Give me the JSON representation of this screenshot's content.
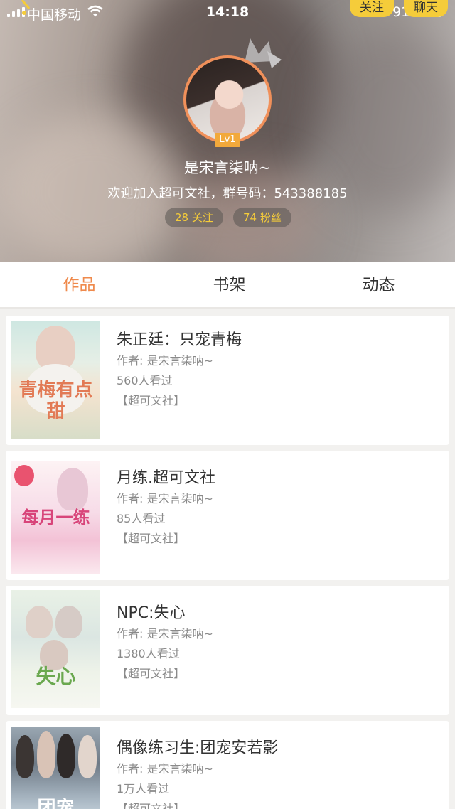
{
  "status_bar": {
    "carrier": "中国移动",
    "time": "14:18",
    "battery": "91%",
    "battery_level": 0.91
  },
  "header_actions": {
    "follow_label": "关注",
    "chat_label": "聊天"
  },
  "profile": {
    "level": "Lv1",
    "name": "是宋言柒呐~",
    "intro": "欢迎加入超可文社，群号码：543388185",
    "following": "28 关注",
    "fans": "74 粉丝"
  },
  "tabs": [
    {
      "label": "作品",
      "active": true
    },
    {
      "label": "书架",
      "active": false
    },
    {
      "label": "动态",
      "active": false
    }
  ],
  "accent_color": "#ef8a4c",
  "books": [
    {
      "title": "朱正廷：只宠青梅",
      "author": "作者: 是宋言柒呐~",
      "views": "560人看过",
      "tag": "【超可文社】",
      "cover_text": "青梅有点甜"
    },
    {
      "title": "月练.超可文社",
      "author": "作者: 是宋言柒呐~",
      "views": "85人看过",
      "tag": "【超可文社】",
      "cover_text": "每月一练"
    },
    {
      "title": "NPC:失心",
      "author": "作者: 是宋言柒呐~",
      "views": "1380人看过",
      "tag": "【超可文社】",
      "cover_text": "失心"
    },
    {
      "title": "偶像练习生:团宠安若影",
      "author": "作者: 是宋言柒呐~",
      "views": "1万人看过",
      "tag": "【超可文社】",
      "cover_text": "团宠"
    }
  ]
}
